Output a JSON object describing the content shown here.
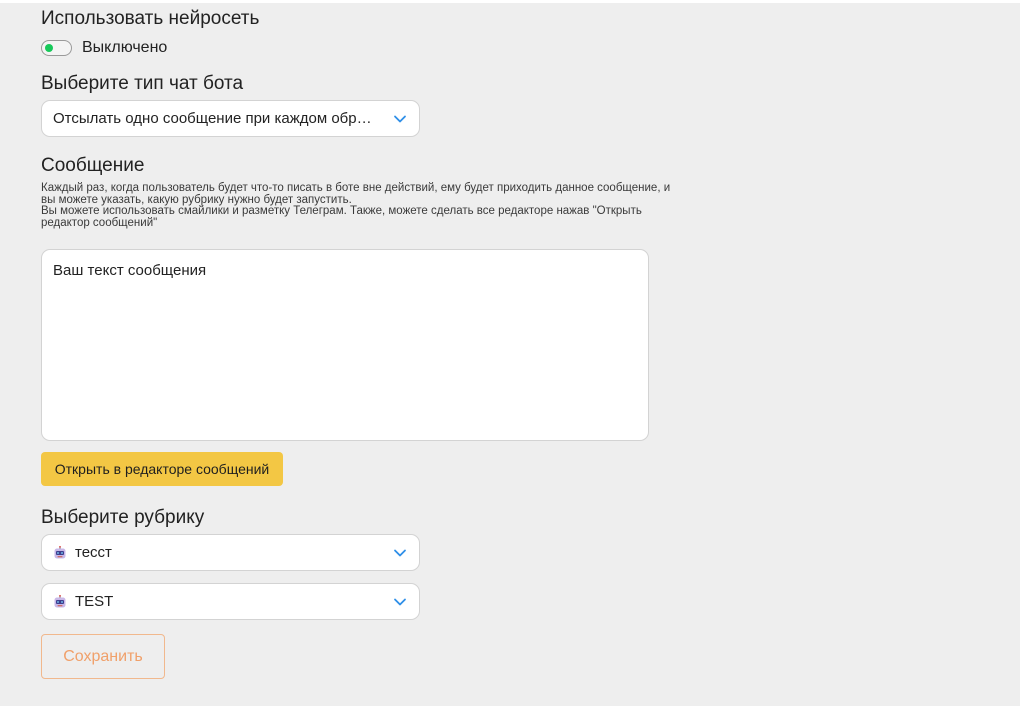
{
  "neural": {
    "heading": "Использовать нейросеть",
    "toggle_label": "Выключено",
    "toggle_on": false
  },
  "bot_type": {
    "heading": "Выберите тип чат бота",
    "selected": "Отсылать одно сообщение при каждом обращении"
  },
  "message": {
    "heading": "Сообщение",
    "description_line1": "Каждый раз, когда пользователь будет что-то писать в боте вне действий, ему будет приходить данное сообщение, и",
    "description_line2": "вы можете указать, какую рубрику нужно будет запустить.",
    "description_line3": "Вы можете использовать смайлики и разметку Телеграм. Также, можете сделать все редакторе нажав \"Открыть",
    "description_line4": "редактор сообщений\"",
    "placeholder": "Ваш текст сообщения",
    "editor_button": "Открыть в редакторе сообщений"
  },
  "rubric": {
    "heading": "Выберите рубрику",
    "selects": [
      {
        "icon": "robot-emoji-icon",
        "value": "тесст"
      },
      {
        "icon": "robot-emoji-icon",
        "value": "TEST"
      }
    ]
  },
  "save_button": "Сохранить",
  "colors": {
    "panel_bg": "#eeeeee",
    "toggle_knob": "#17c95a",
    "primary_yellow": "#f3c744",
    "save_outline": "#f1b88d",
    "save_text": "#f0a06a",
    "chevron": "#2f8fe8"
  }
}
